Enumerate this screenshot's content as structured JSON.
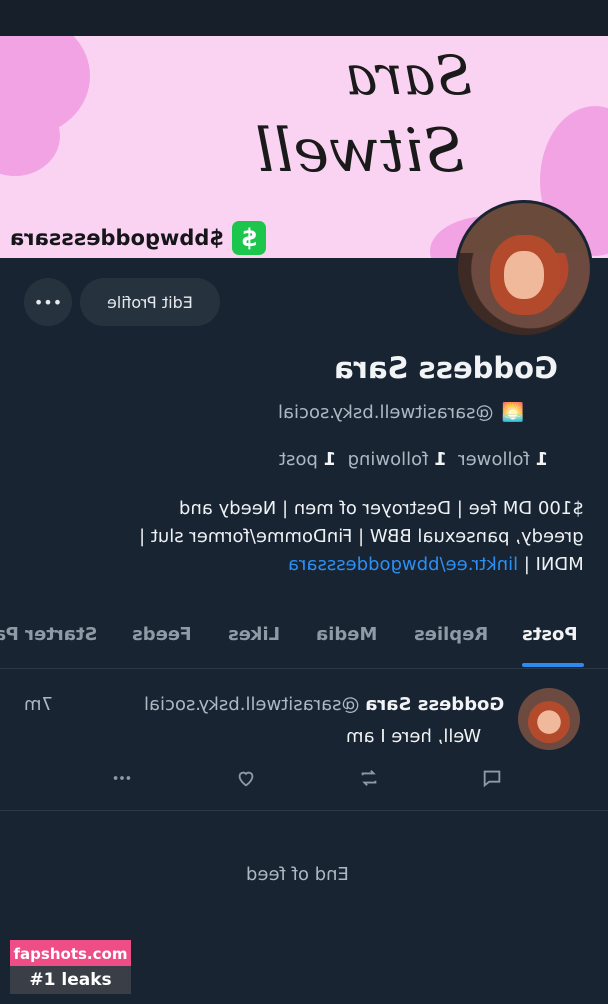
{
  "banner": {
    "cashtag": "$bbwgoddesssara",
    "cash_logo": "$",
    "signature_line1": "Sara",
    "signature_line2": "Sitwell",
    "colors": {
      "background": "#fbd3f2",
      "blobs": "#f2a3e4",
      "cashapp": "#1cc54b"
    }
  },
  "profile": {
    "edit_label": "Edit Profile",
    "more_label": "•••",
    "display_name": "Goddess Sara",
    "handle": "@sarasitwell.bsky.social",
    "handle_emoji": "🌅",
    "followers_count": "1",
    "followers_label": "follower",
    "following_count": "1",
    "following_label": "following",
    "posts_count": "1",
    "posts_label": "post",
    "bio_line1": "$100 DM fee | Destroyer of men | Needy and",
    "bio_line2": "greedy, pansexual BBW | FinDomme/former slut |",
    "bio_line3_prefix": "MDNI | ",
    "bio_link": "linktr.ee/bbwgoddesssara"
  },
  "tabs": [
    {
      "label": "Posts"
    },
    {
      "label": "Replies"
    },
    {
      "label": "Media"
    },
    {
      "label": "Likes"
    },
    {
      "label": "Feeds"
    },
    {
      "label": "Starter Pa"
    }
  ],
  "post": {
    "author": "Goddess Sara",
    "handle": "@sarasitwell.bsky.social",
    "time": "7m",
    "text": "Well, here I am"
  },
  "feed_end": "End of feed",
  "watermark": {
    "site": "fapshots.com",
    "tagline": "#1 leaks"
  },
  "accent": "#2d8bf0"
}
